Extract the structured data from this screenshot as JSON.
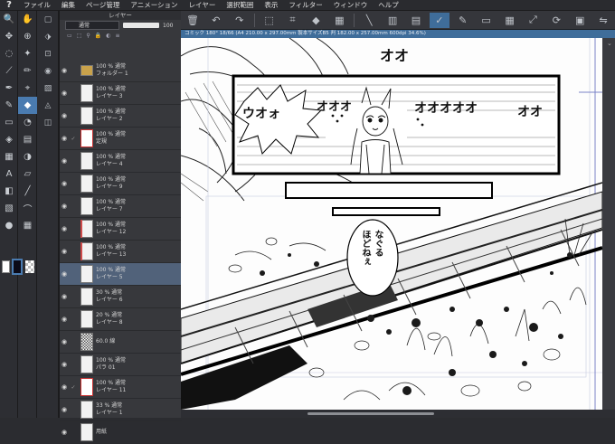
{
  "app": {
    "logo": "?"
  },
  "menu": [
    "ファイル",
    "編集",
    "ページ管理",
    "アニメーション",
    "レイヤー",
    "選択範囲",
    "表示",
    "フィルター",
    "ウィンドウ",
    "ヘルプ"
  ],
  "layer_panel": {
    "title": "レイヤー",
    "blend_mode": "通常",
    "opacity_value": "100",
    "layers": [
      {
        "line1": "100 % 通常",
        "line2": "フォルダー 1",
        "type": "folder"
      },
      {
        "line1": "100 % 通常",
        "line2": "レイヤー 3",
        "type": "raster"
      },
      {
        "line1": "100 % 通常",
        "line2": "レイヤー 2",
        "type": "raster"
      },
      {
        "line1": "100 % 通常",
        "line2": "定規",
        "type": "ruler"
      },
      {
        "line1": "100 % 通常",
        "line2": "レイヤー 4",
        "type": "raster"
      },
      {
        "line1": "100 % 通常",
        "line2": "レイヤー 9",
        "type": "raster"
      },
      {
        "line1": "100 % 通常",
        "line2": "レイヤー 7",
        "type": "raster"
      },
      {
        "line1": "100 % 通常",
        "line2": "レイヤー 12",
        "type": "raster",
        "red": true
      },
      {
        "line1": "100 % 通常",
        "line2": "レイヤー 13",
        "type": "raster",
        "red": true
      },
      {
        "line1": "100 % 通常",
        "line2": "レイヤー 5",
        "type": "raster",
        "selected": true
      },
      {
        "line1": "30 % 通常",
        "line2": "レイヤー 6",
        "type": "raster"
      },
      {
        "line1": "20 % 通常",
        "line2": "レイヤー 8",
        "type": "raster"
      },
      {
        "line1": "60.0 線",
        "line2": "",
        "type": "tone"
      },
      {
        "line1": "100 % 通常",
        "line2": "パラ 01",
        "type": "raster"
      },
      {
        "line1": "100 % 通常",
        "line2": "レイヤー 11",
        "type": "ruler"
      },
      {
        "line1": "33 % 通常",
        "line2": "レイヤー 1",
        "type": "raster"
      },
      {
        "line1": "用紙",
        "line2": "",
        "type": "paper"
      }
    ]
  },
  "canvas": {
    "title": "コミック 180° 18/66 (A4 210.00 x 297.00mm 製本サイズB5 判 182.00 x 257.00mm 600dpi 34.6%)",
    "sfx_left": "ウオォ",
    "sfx_mid": "オオオ",
    "sfx_right1": "オオオオオ",
    "sfx_right2": "オオ",
    "sfx_top": "オオ",
    "speech": "なぐる\nほどねぇ"
  },
  "colors": {
    "accent": "#3f6d9a",
    "selected_layer": "#51627a"
  }
}
